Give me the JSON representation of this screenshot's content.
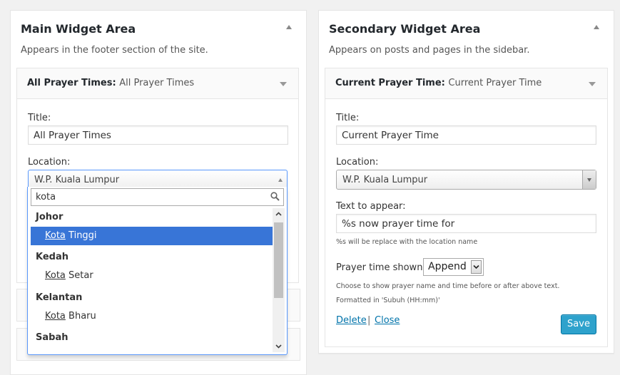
{
  "main_area": {
    "title": "Main Widget Area",
    "description": "Appears in the footer section of the site.",
    "widget": {
      "name": "All Prayer Times:",
      "instance_title": "All Prayer Times",
      "title_label": "Title:",
      "title_value": "All Prayer Times",
      "location_label": "Location:",
      "location_value": "W.P. Kuala Lumpur"
    },
    "dropdown": {
      "search_value": "kota",
      "groups": [
        {
          "label": "Johor",
          "option_match": "Kota",
          "option_rest": " Tinggi",
          "highlighted": true
        },
        {
          "label": "Kedah",
          "option_match": "Kota",
          "option_rest": " Setar",
          "highlighted": false
        },
        {
          "label": "Kelantan",
          "option_match": "Kota",
          "option_rest": " Bharu",
          "highlighted": false
        },
        {
          "label": "Sabah"
        }
      ]
    }
  },
  "secondary_area": {
    "title": "Secondary Widget Area",
    "description": "Appears on posts and pages in the sidebar.",
    "widget": {
      "name": "Current Prayer Time:",
      "instance_title": "Current Prayer Time",
      "title_label": "Title:",
      "title_value": "Current Prayer Time",
      "location_label": "Location:",
      "location_value": "W.P. Kuala Lumpur",
      "text_label": "Text to appear:",
      "text_value": "%s now prayer time for",
      "text_note": "%s will be replace with the location name",
      "shown_label": "Prayer time shown:",
      "shown_value": "Append",
      "shown_note_1": "Choose to show prayer name and time before or after above text.",
      "shown_note_2": "Formatted in 'Subuh (HH:mm)'",
      "delete_label": "Delete",
      "separator": "|",
      "close_label": "Close",
      "save_label": "Save"
    }
  },
  "colors": {
    "accent": "#2ea2cc",
    "link": "#0073aa",
    "highlight": "#3875d7",
    "focus_border": "#5897fb"
  },
  "icons": [
    "collapse-arrow-icon",
    "widget-toggle-icon",
    "search-icon",
    "chevron-up-icon",
    "chevron-down-icon"
  ]
}
